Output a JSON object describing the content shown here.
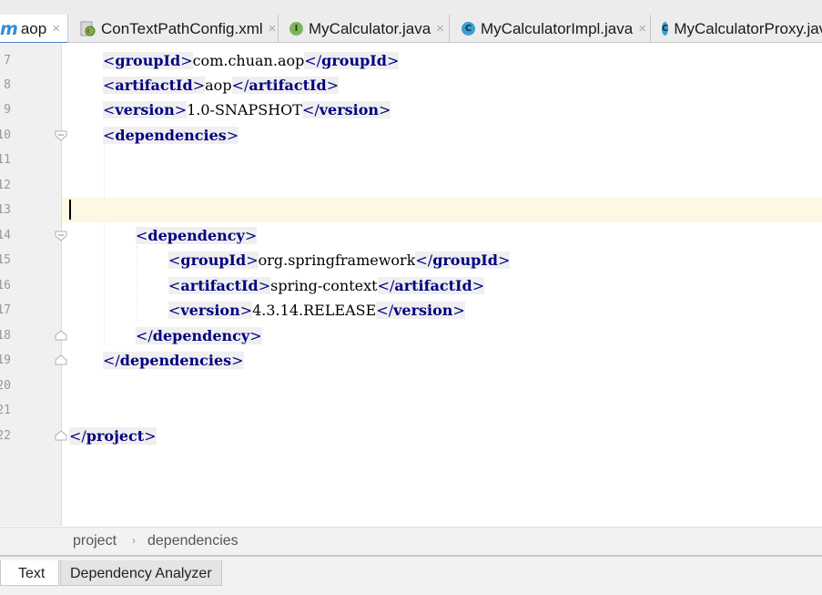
{
  "tabs": [
    {
      "label": "aop",
      "icon": "maven-m-icon",
      "active": true
    },
    {
      "label": "ConTextPathConfig.xml",
      "icon": "xml-file-icon",
      "active": false
    },
    {
      "label": "MyCalculator.java",
      "icon": "interface-i-icon",
      "active": false
    },
    {
      "label": "MyCalculatorImpl.java",
      "icon": "class-c-icon",
      "active": false
    },
    {
      "label": "MyCalculatorProxy.jav",
      "icon": "class-c-icon",
      "active": false
    }
  ],
  "icon_glyphs": {
    "maven": "m",
    "interface": "I",
    "class": "C",
    "close": "×"
  },
  "lines": [
    {
      "num": "7",
      "open": "groupId",
      "value": "com.chuan.aop",
      "close": "groupId"
    },
    {
      "num": "8",
      "open": "artifactId",
      "value": "aop",
      "close": "artifactId"
    },
    {
      "num": "9",
      "open": "version",
      "value": "1.0-SNAPSHOT",
      "close": "version"
    },
    {
      "num": "10",
      "open": "dependencies"
    },
    {
      "num": "11"
    },
    {
      "num": "12"
    },
    {
      "num": "13"
    },
    {
      "num": "14",
      "open": "dependency"
    },
    {
      "num": "15",
      "open": "groupId",
      "value": "org.springframework",
      "close": "groupId"
    },
    {
      "num": "16",
      "open": "artifactId",
      "value": "spring-context",
      "close": "artifactId"
    },
    {
      "num": "17",
      "open": "version",
      "value": "4.3.14.RELEASE",
      "close": "version"
    },
    {
      "num": "18",
      "close": "dependency"
    },
    {
      "num": "19",
      "close": "dependencies"
    },
    {
      "num": "20"
    },
    {
      "num": "21"
    },
    {
      "num": "22",
      "close": "project"
    }
  ],
  "breadcrumb": [
    "project",
    "dependencies"
  ],
  "breadcrumb_separator": "›",
  "bottom_tabs": [
    {
      "label": "Text",
      "active": true
    },
    {
      "label": "Dependency Analyzer",
      "active": false
    }
  ],
  "colors": {
    "tag": "#000080",
    "current_line": "#fdf8e3",
    "gutter": "#f0f0f0",
    "tab_accent": "#4a86c8"
  }
}
